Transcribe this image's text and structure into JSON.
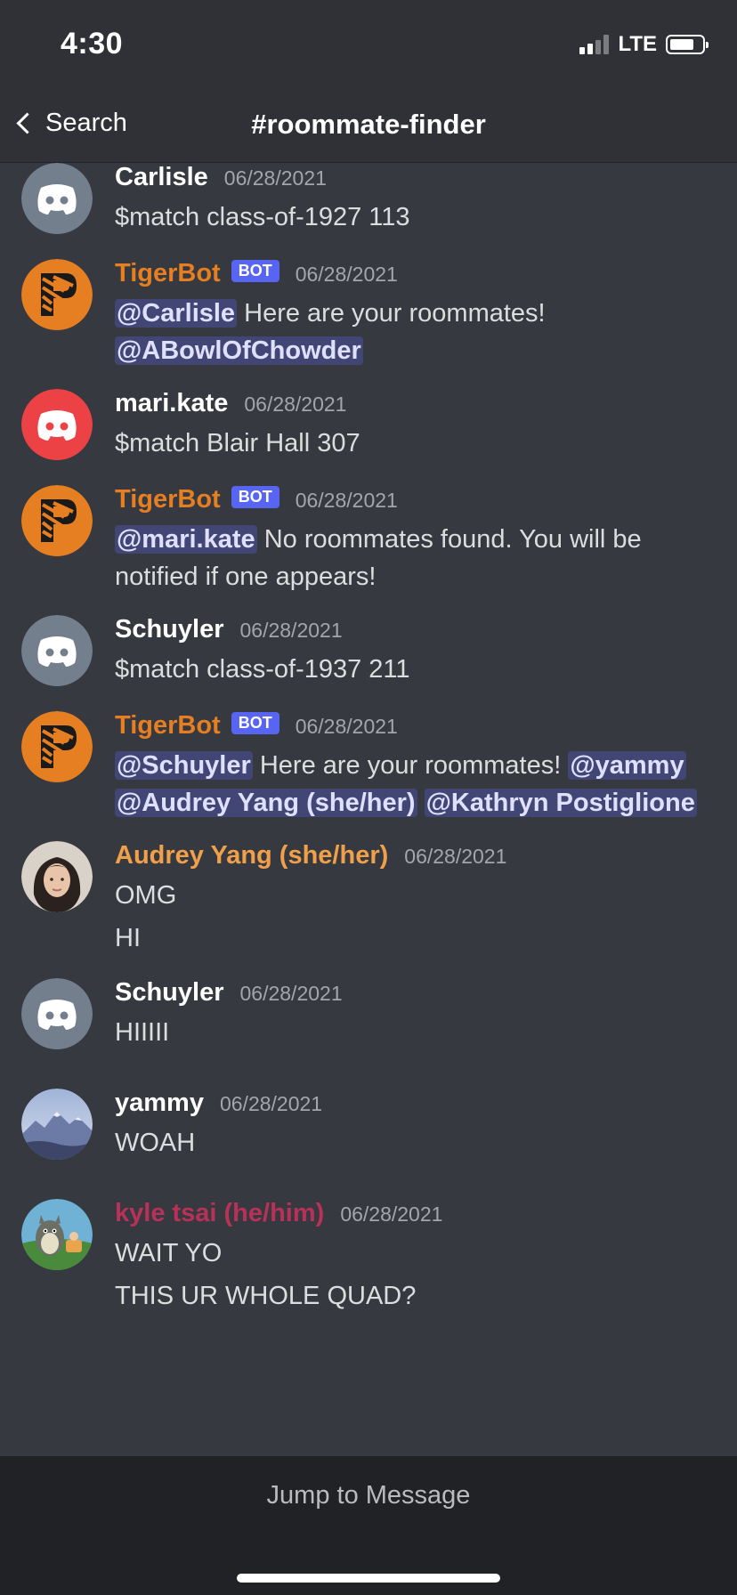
{
  "status": {
    "time": "4:30",
    "network": "LTE",
    "signal_bars_on": 2,
    "signal_bars_total": 4,
    "battery_level": 0.75
  },
  "nav": {
    "back_label": "Search",
    "channel": "#roommate-finder"
  },
  "colors": {
    "bot_name": "#e67e22",
    "mention_bg": "#414675",
    "badge_bg": "#5865f2",
    "discord_grey": "#747f8d",
    "discord_red": "#ed4245"
  },
  "messages": [
    {
      "author": "Carlisle",
      "time": "06/28/2021",
      "lines": [
        "$match class-of-1927 113"
      ]
    },
    {
      "author": "TigerBot",
      "badge": "BOT",
      "time": "06/28/2021",
      "mention1": "@Carlisle",
      "text1": " Here are your roommates!",
      "mention2": "@ABowlOfChowder"
    },
    {
      "author": "mari.kate",
      "time": "06/28/2021",
      "lines": [
        "$match Blair Hall 307"
      ]
    },
    {
      "author": "TigerBot",
      "badge": "BOT",
      "time": "06/28/2021",
      "mention1": "@mari.kate",
      "text1": " No roommates found. You will be notified if one appears!"
    },
    {
      "author": "Schuyler",
      "time": "06/28/2021",
      "lines": [
        "$match class-of-1937 211"
      ]
    },
    {
      "author": "TigerBot",
      "badge": "BOT",
      "time": "06/28/2021",
      "mention1": "@Schuyler",
      "text1": " Here are your roommates! ",
      "mention2": "@yammy",
      "mention3": "@Audrey Yang (she/her)",
      "mention4": "@Kathryn Postiglione"
    },
    {
      "author": "Audrey Yang (she/her)",
      "time": "06/28/2021",
      "lines": [
        "OMG",
        "HI"
      ]
    },
    {
      "author": "Schuyler",
      "time": "06/28/2021",
      "lines": [
        "HIIIII"
      ]
    },
    {
      "author": "yammy",
      "time": "06/28/2021",
      "lines": [
        "WOAH"
      ]
    },
    {
      "author": "kyle tsai (he/him)",
      "time": "06/28/2021",
      "lines": [
        "WAIT YO",
        "THIS UR WHOLE QUAD?"
      ]
    }
  ],
  "jump_label": "Jump to Message"
}
